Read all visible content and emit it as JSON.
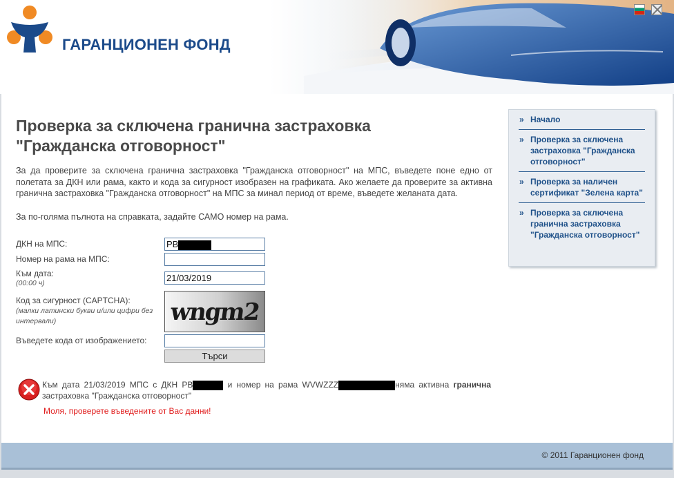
{
  "header": {
    "brand": "ГАРАНЦИОНЕН ФОНД",
    "languages": [
      "bg-flag-icon",
      "en-flag-icon"
    ]
  },
  "content": {
    "title_line1": "Проверка за сключена гранична застраховка",
    "title_line2": "\"Гражданска отговорност\"",
    "intro": "За да проверите за сключена гранична застраховка \"Гражданска отговорност\" на МПС, въведете поне едно от полетата за ДКН или рама, както и кода за сигурност изобразен на графиката. Ако желаете да проверите за активна гранична застраховка \"Гражданска отговорност\" на МПС за минал период от време, въведете желаната дата.",
    "intro2": "За по-голяма пълнота на справката, задайте САМО номер на рама."
  },
  "form": {
    "plate_label": "ДКН на МПС:",
    "plate_value": "PB",
    "vin_label": "Номер на рама на МПС:",
    "vin_value": "",
    "date_label": "Към дата:",
    "date_hint": "(00:00 ч)",
    "date_value": "21/03/2019",
    "captcha_label": "Код за сигурност (CAPTCHA):",
    "captcha_hint": "(малки латински букви и/или цифри без интервали)",
    "captcha_text": "wngm2",
    "code_label": "Въведете кода от изображението:",
    "code_value": "",
    "submit_label": "Търси"
  },
  "result": {
    "part1": "Към дата 21/03/2019 МПС с ДКН PB",
    "part2": " и номер на рама WVWZZZ",
    "part3": "няма активна ",
    "bold": "гранична",
    "part4": " застраховка \"Гражданска отговорност\"",
    "error": "Моля, проверете въведените от Вас данни!"
  },
  "sidebar": {
    "items": [
      "Начало",
      "Проверка за сключена застраховка \"Гражданска отговорност\"",
      "Проверка за наличен сертификат \"Зелена карта\"",
      "Проверка за сключена гранична застраховка \"Гражданска отговорност\""
    ]
  },
  "footer": {
    "copyright": "© 2011 Гаранционен фонд"
  },
  "colors": {
    "brand_blue": "#1b4a8a",
    "link_blue": "#1f5189",
    "error_red": "#e01b1b",
    "footer_bg": "#a9c0d7",
    "logo_orange": "#f08a24"
  }
}
